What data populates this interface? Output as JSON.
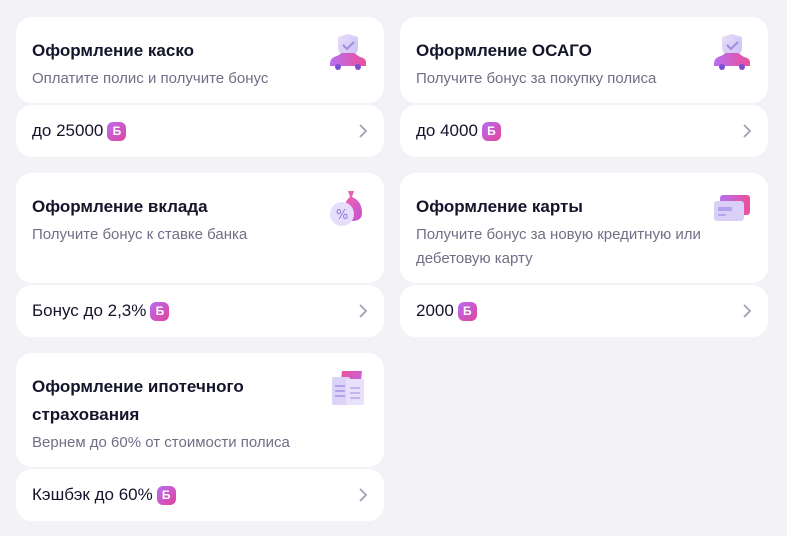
{
  "cards": [
    {
      "title": "Оформление каско",
      "subtitle": "Оплатите полис и получите бонус",
      "amount": "до 25000",
      "badge": "Б",
      "icon": "car-shield-icon"
    },
    {
      "title": "Оформление ОСАГО",
      "subtitle": "Получите бонус за покупку полиса",
      "amount": "до 4000",
      "badge": "Б",
      "icon": "car-shield-icon"
    },
    {
      "title": "Оформление вклада",
      "subtitle": "Получите бонус к ставке банка",
      "amount": "Бонус до 2,3%",
      "badge": "Б",
      "icon": "money-bag-percent-icon"
    },
    {
      "title": "Оформление карты",
      "subtitle": "Получите бонус за новую кредитную или дебетовую карту",
      "amount": "2000",
      "badge": "Б",
      "icon": "cards-icon"
    },
    {
      "title": "Оформление ипотечного страхования",
      "subtitle": "Вернем до 60% от стоимости полиса",
      "amount": "Кэшбэк до 60%",
      "badge": "Б",
      "icon": "documents-icon"
    }
  ],
  "colors": {
    "background": "#f3f3f7",
    "card": "#ffffff",
    "title": "#14142b",
    "subtitle": "#6f6f86",
    "badge_from": "#b86cf0",
    "badge_to": "#e0449c",
    "chevron": "#a0a0b4"
  }
}
